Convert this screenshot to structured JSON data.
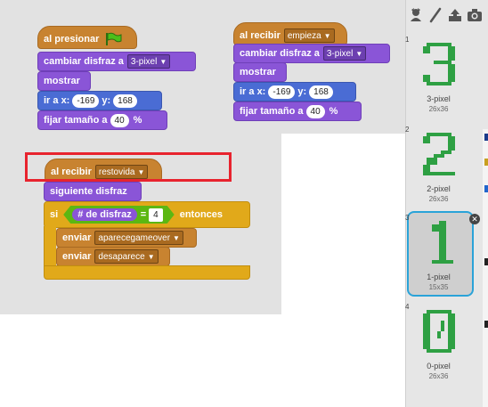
{
  "scripts": {
    "script1": {
      "hat": "al presionar",
      "costume_label": "cambiar disfraz a",
      "costume_value": "3-pixel",
      "show": "mostrar",
      "goto_label": "ir a x:",
      "goto_x": "-169",
      "goto_y_label": "y:",
      "goto_y": "168",
      "size_label": "fijar tamaño a",
      "size_value": "40",
      "size_unit": "%"
    },
    "script2": {
      "hat": "al recibir",
      "message": "empieza",
      "costume_label": "cambiar disfraz a",
      "costume_value": "3-pixel",
      "show": "mostrar",
      "goto_label": "ir a x:",
      "goto_x": "-169",
      "goto_y_label": "y:",
      "goto_y": "168",
      "size_label": "fijar tamaño a",
      "size_value": "40",
      "size_unit": "%"
    },
    "script3": {
      "hat": "al recibir",
      "message": "restovida",
      "next_costume": "siguiente disfraz",
      "if_label": "si",
      "reporter": "# de disfraz",
      "equals": "=",
      "compare_value": "4",
      "then_label": "entonces",
      "broadcast1_label": "enviar",
      "broadcast1_value": "aparecegameover",
      "broadcast2_label": "enviar",
      "broadcast2_value": "desaparece"
    }
  },
  "costumes": [
    {
      "index": "1",
      "name": "3-pixel",
      "size": "26x36",
      "glyph": "3"
    },
    {
      "index": "2",
      "name": "2-pixel",
      "size": "26x36",
      "glyph": "2"
    },
    {
      "index": "3",
      "name": "1-pixel",
      "size": "15x35",
      "glyph": "1"
    },
    {
      "index": "4",
      "name": "0-pixel",
      "size": "26x36",
      "glyph": "0"
    }
  ],
  "toolbar_icons": [
    "paint-sprite-icon",
    "paint-brush-icon",
    "upload-icon",
    "camera-icon"
  ],
  "colors": {
    "event": "#c88330",
    "looks": "#8a55d7",
    "motion": "#4a6cd4",
    "control": "#e1a91a",
    "operator": "#5cb712",
    "costume_digit": "#2ea043",
    "highlight": "#e8232e",
    "selected": "#2aa3d8"
  }
}
